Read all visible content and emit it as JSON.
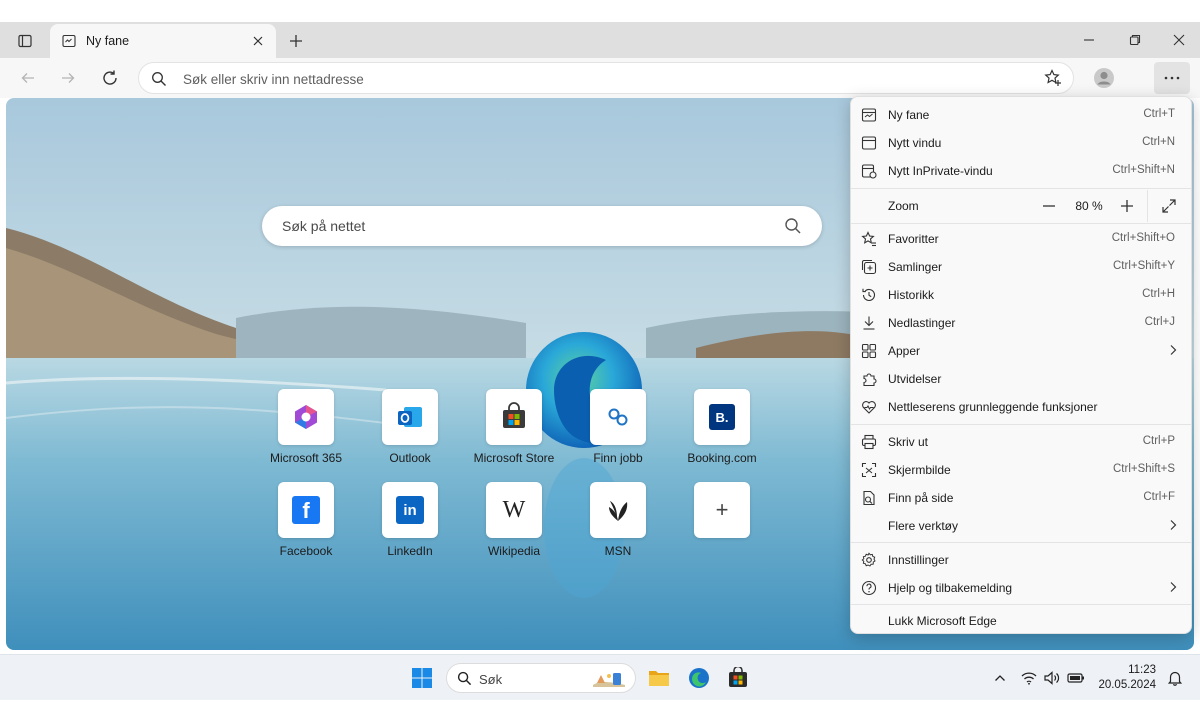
{
  "window": {
    "tab_title": "Ny fane",
    "address_placeholder": "Søk eller skriv inn nettadresse"
  },
  "newtab": {
    "search_placeholder": "Søk på nettet",
    "tiles": [
      {
        "label": "Microsoft 365",
        "icon": "microsoft-365-icon"
      },
      {
        "label": "Outlook",
        "icon": "outlook-icon"
      },
      {
        "label": "Microsoft Store",
        "icon": "store-icon"
      },
      {
        "label": "Finn jobb",
        "icon": "link-icon"
      },
      {
        "label": "Booking.com",
        "icon": "booking-icon"
      },
      {
        "label": "Facebook",
        "icon": "facebook-icon"
      },
      {
        "label": "LinkedIn",
        "icon": "linkedin-icon"
      },
      {
        "label": "Wikipedia",
        "icon": "wikipedia-icon"
      },
      {
        "label": "MSN",
        "icon": "msn-icon"
      },
      {
        "label": "",
        "icon": "add-icon"
      }
    ],
    "booking_glyph": "B.",
    "linkedin_glyph": "in",
    "wikipedia_glyph": "W",
    "facebook_glyph": "f",
    "add_glyph": "+"
  },
  "menu": {
    "items": {
      "new_tab": {
        "label": "Ny fane",
        "shortcut": "Ctrl+T"
      },
      "new_window": {
        "label": "Nytt vindu",
        "shortcut": "Ctrl+N"
      },
      "inprivate": {
        "label": "Nytt InPrivate-vindu",
        "shortcut": "Ctrl+Shift+N"
      },
      "favorites": {
        "label": "Favoritter",
        "shortcut": "Ctrl+Shift+O"
      },
      "collections": {
        "label": "Samlinger",
        "shortcut": "Ctrl+Shift+Y"
      },
      "history": {
        "label": "Historikk",
        "shortcut": "Ctrl+H"
      },
      "downloads": {
        "label": "Nedlastinger",
        "shortcut": "Ctrl+J"
      },
      "apps": {
        "label": "Apper"
      },
      "extensions": {
        "label": "Utvidelser"
      },
      "essentials": {
        "label": "Nettleserens grunnleggende funksjoner"
      },
      "print": {
        "label": "Skriv ut",
        "shortcut": "Ctrl+P"
      },
      "screenshot": {
        "label": "Skjermbilde",
        "shortcut": "Ctrl+Shift+S"
      },
      "find": {
        "label": "Finn på side",
        "shortcut": "Ctrl+F"
      },
      "more_tools": {
        "label": "Flere verktøy"
      },
      "settings": {
        "label": "Innstillinger"
      },
      "help": {
        "label": "Hjelp og tilbakemelding"
      },
      "close_edge": {
        "label": "Lukk Microsoft Edge"
      }
    },
    "zoom": {
      "label": "Zoom",
      "value": "80 %"
    }
  },
  "taskbar": {
    "search_placeholder": "Søk",
    "time": "11:23",
    "date": "20.05.2024"
  },
  "colors": {
    "edge_blue": "#1a73c9",
    "edge_green": "#3ec46d",
    "accent": "#0067c0"
  }
}
